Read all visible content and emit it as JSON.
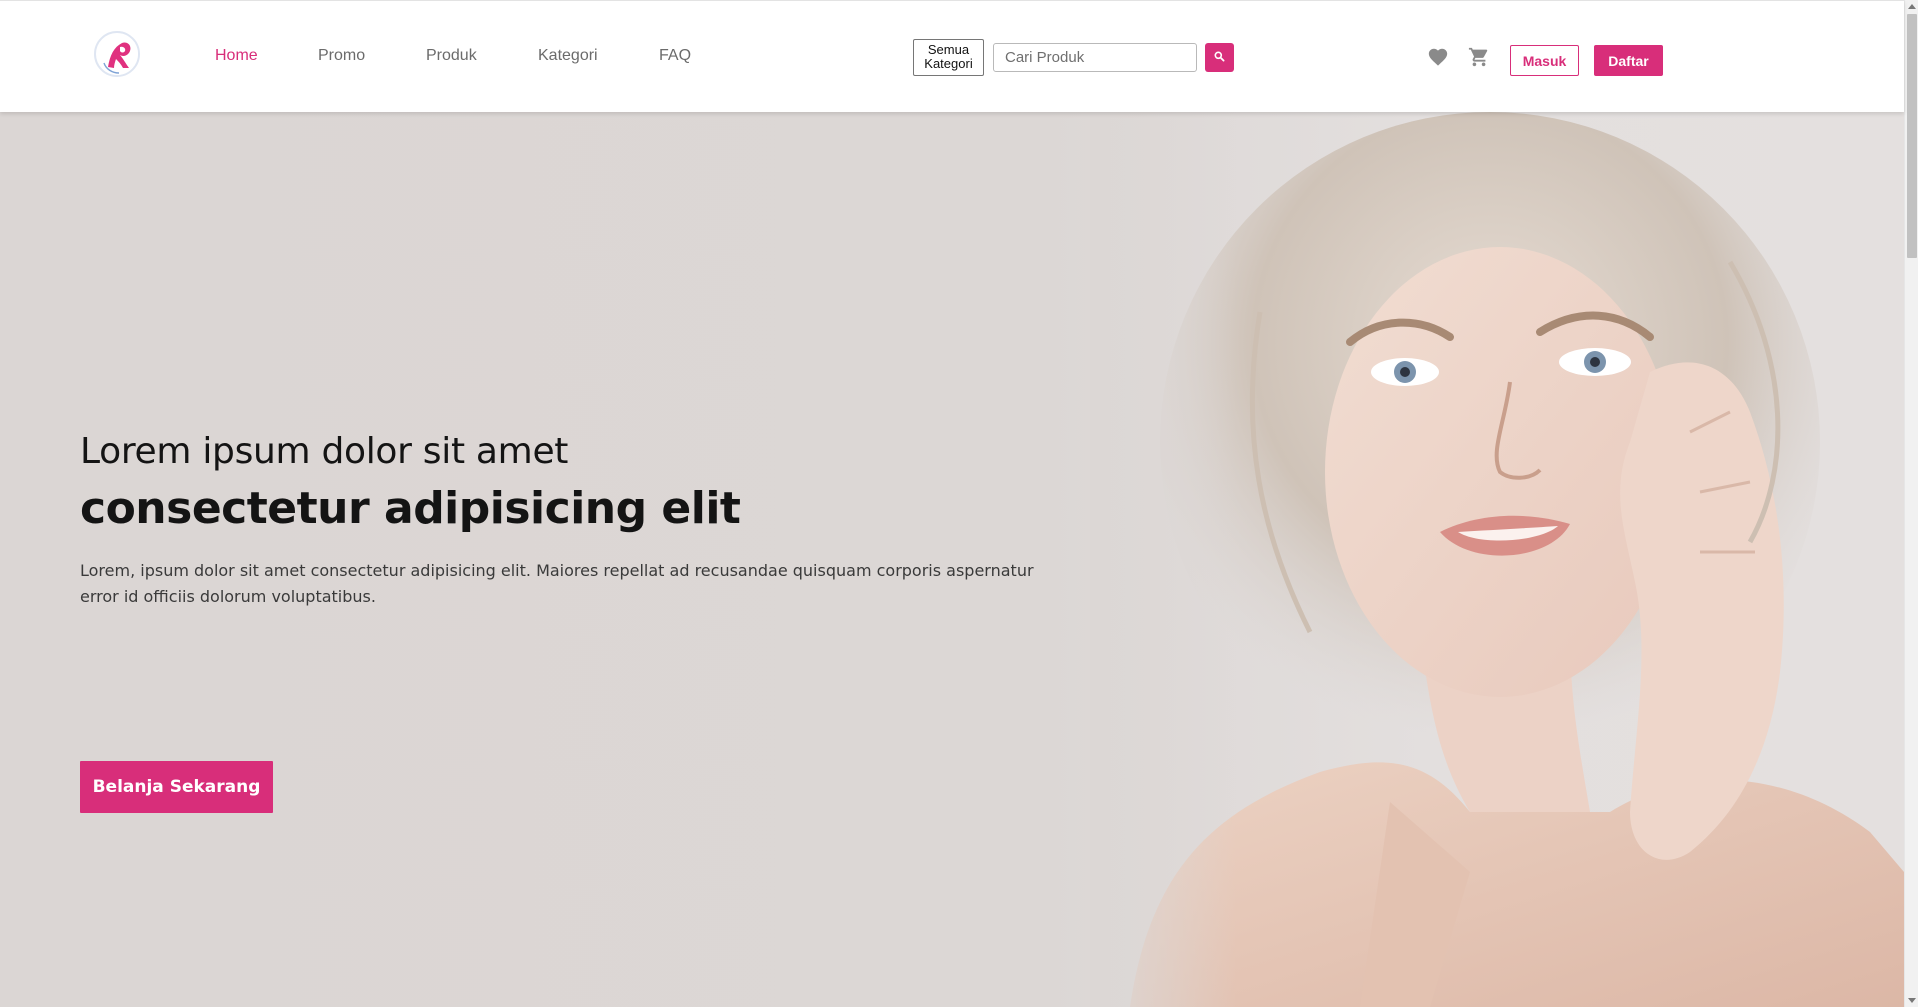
{
  "nav": {
    "items": [
      {
        "label": "Home",
        "active": true
      },
      {
        "label": "Promo",
        "active": false
      },
      {
        "label": "Produk",
        "active": false
      },
      {
        "label": "Kategori",
        "active": false
      },
      {
        "label": "FAQ",
        "active": false
      }
    ]
  },
  "search": {
    "category_label": "Semua Kategori",
    "placeholder": "Cari Produk",
    "button_icon": "search-icon"
  },
  "actions": {
    "wishlist_icon": "heart-icon",
    "cart_icon": "cart-icon",
    "login_label": "Masuk",
    "register_label": "Daftar"
  },
  "hero": {
    "line1": "Lorem ipsum dolor sit amet",
    "line2": "consectetur adipisicing elit",
    "description": "Lorem, ipsum dolor sit amet consectetur adipisicing elit. Maiores repellat ad recusandae quisquam corporis aspernatur error id officiis dolorum voluptatibus.",
    "cta_label": "Belanja Sekarang"
  },
  "colors": {
    "accent": "#d82e7a",
    "nav_text": "#6b6b6b",
    "hero_bg": "#dbd6d4"
  }
}
